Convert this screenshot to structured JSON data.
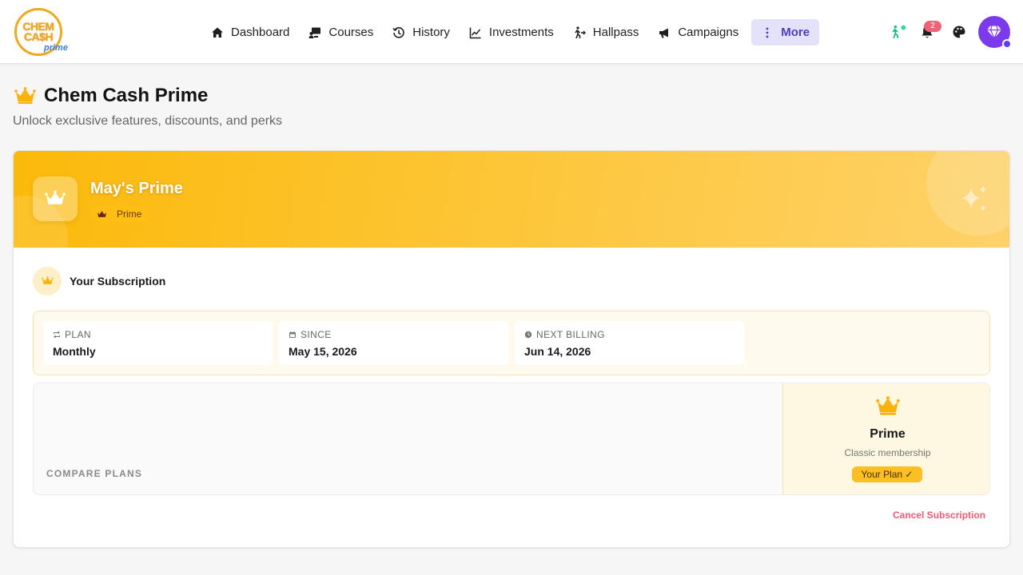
{
  "brand": {
    "logo_line1": "CHEM",
    "logo_line2": "CA$H",
    "logo_line3": "prime"
  },
  "nav": {
    "items": [
      {
        "label": "Dashboard",
        "icon": "home-icon"
      },
      {
        "label": "Courses",
        "icon": "courses-icon"
      },
      {
        "label": "History",
        "icon": "history-icon"
      },
      {
        "label": "Investments",
        "icon": "chart-line-icon"
      },
      {
        "label": "Hallpass",
        "icon": "walking-icon"
      },
      {
        "label": "Campaigns",
        "icon": "megaphone-icon"
      },
      {
        "label": "More",
        "icon": "more-vertical-icon",
        "active": true
      }
    ]
  },
  "header_icons": {
    "notifications_count": "2"
  },
  "page": {
    "title": "Chem Cash Prime",
    "subtitle": "Unlock exclusive features, discounts, and perks"
  },
  "hero": {
    "name": "May's Prime",
    "tier": "Prime"
  },
  "subscription": {
    "heading": "Your Subscription",
    "plan_label": "PLAN",
    "plan_value": "Monthly",
    "since_label": "SINCE",
    "since_value": "May 15, 2026",
    "billing_label": "NEXT BILLING",
    "billing_value": "Jun 14, 2026"
  },
  "compare": {
    "label": "COMPARE PLANS",
    "plan_name": "Prime",
    "plan_desc": "Classic membership",
    "current_badge": "Your Plan ✓"
  },
  "actions": {
    "cancel_label": "Cancel Subscription"
  },
  "colors": {
    "accent": "#fbbf24",
    "nav_active_bg": "#e4e1fb",
    "nav_active_text": "#4a3fb8",
    "danger": "#ef5a75",
    "avatar": "#7c3aed"
  }
}
